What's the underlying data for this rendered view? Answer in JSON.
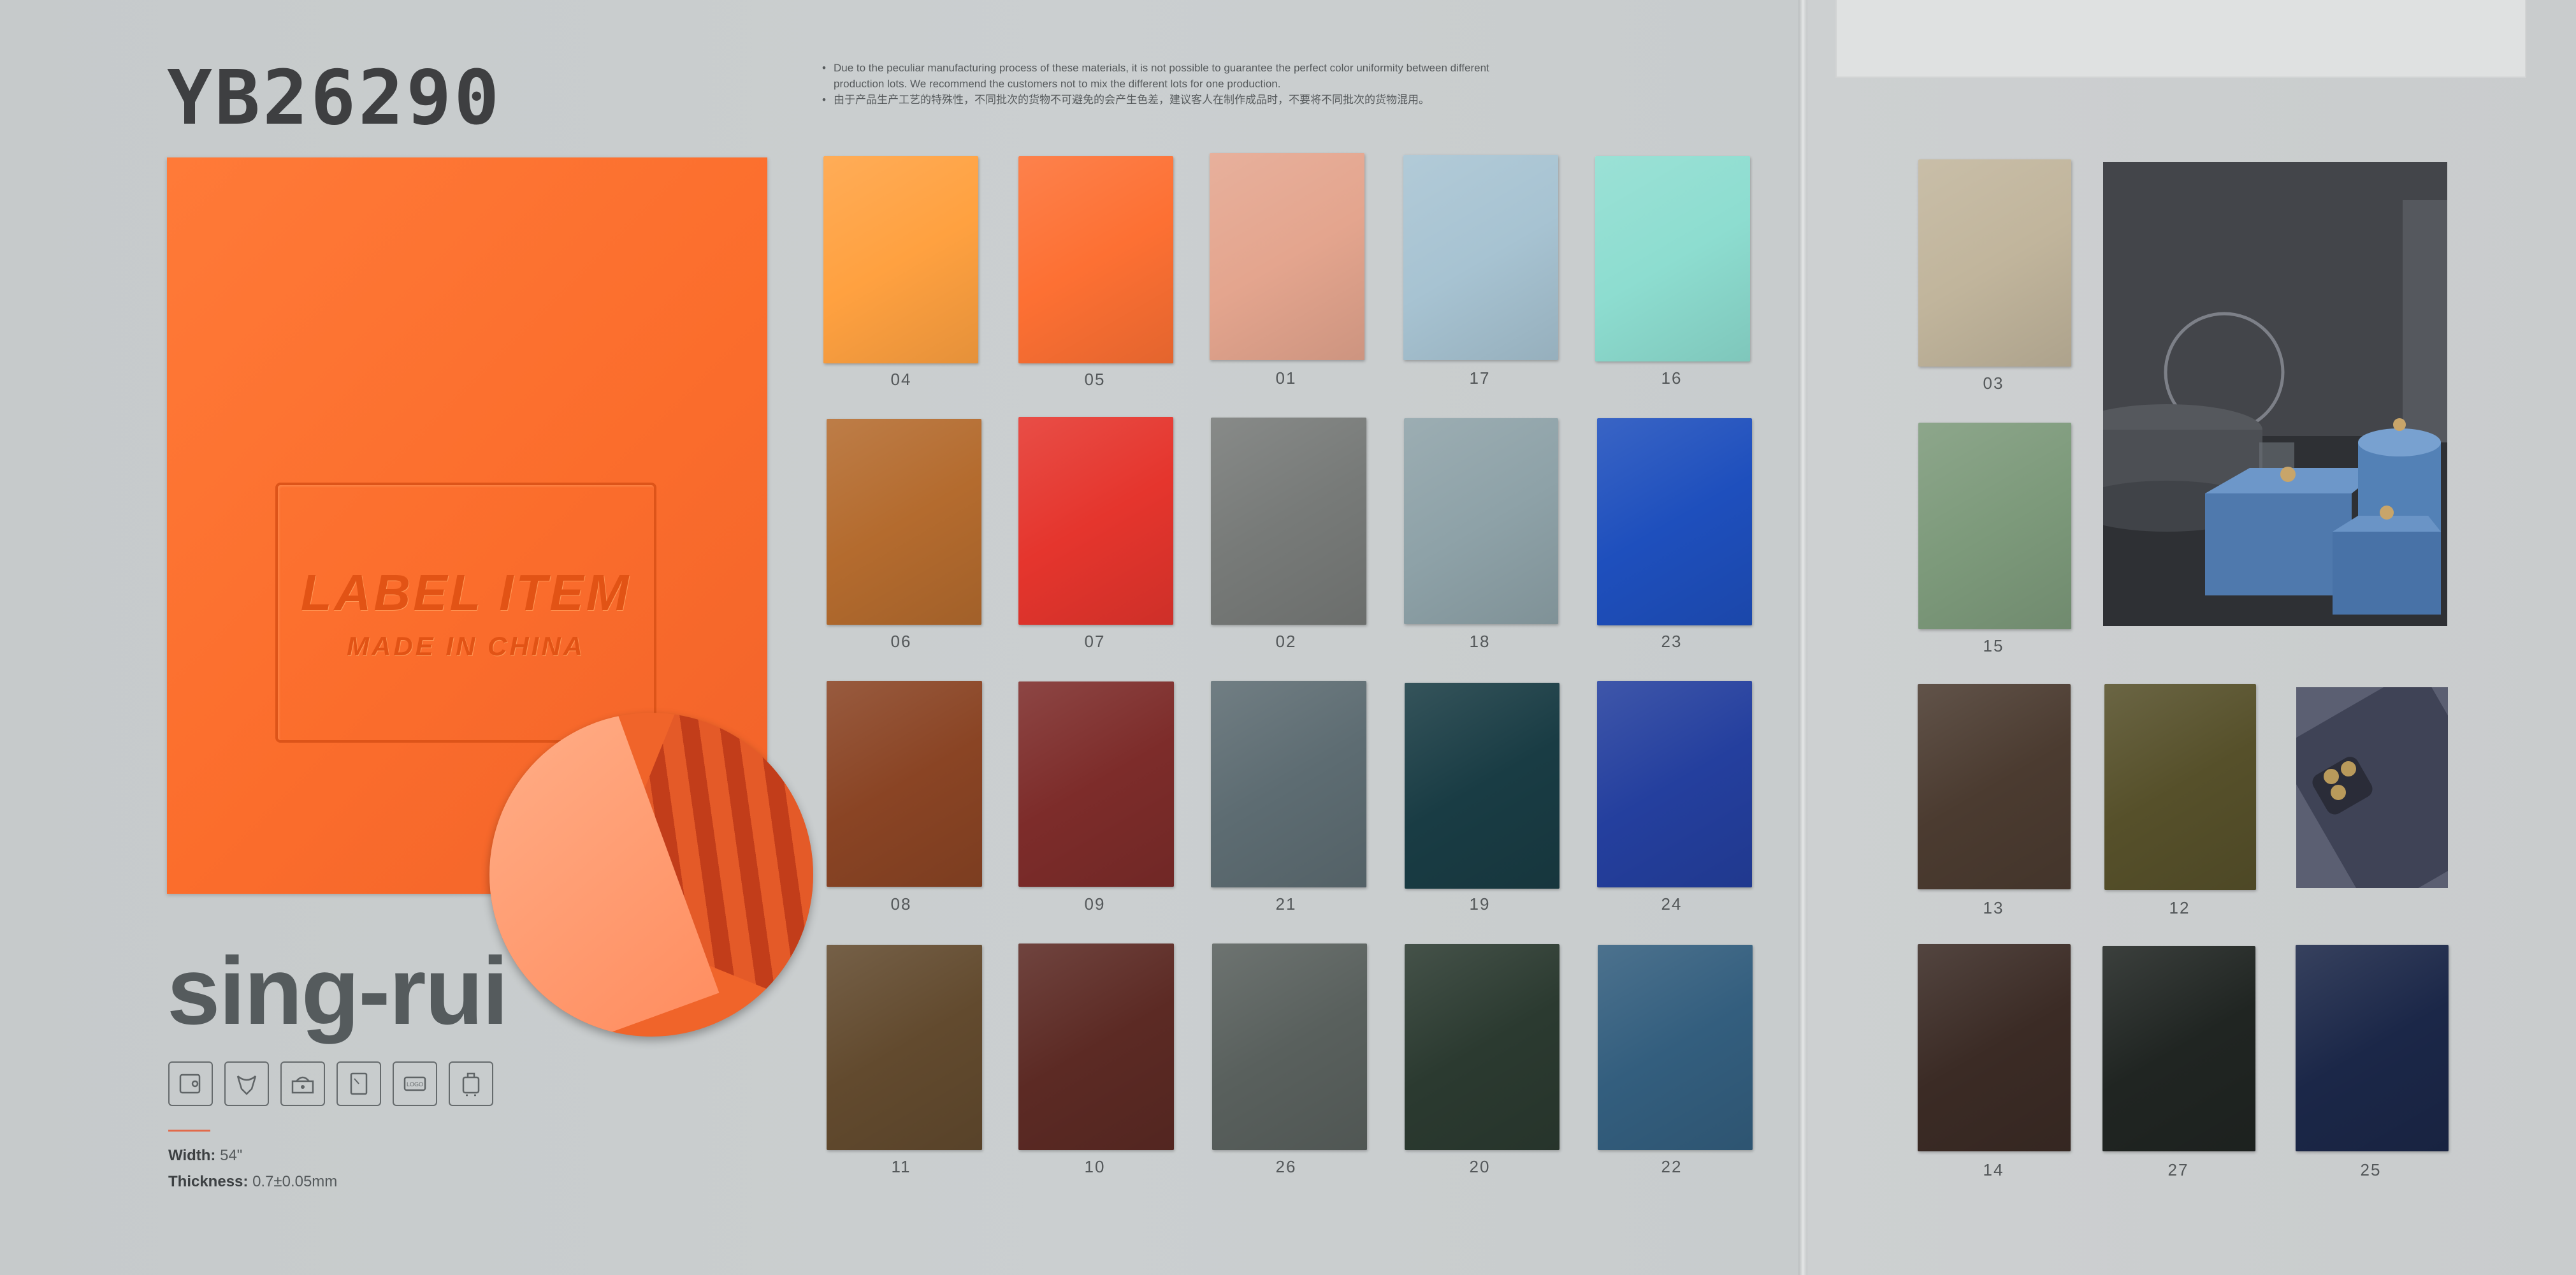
{
  "header": {
    "code": "YB26290",
    "notice": [
      "Due to the peculiar manufacturing process of these materials, it is not possible to guarantee the perfect color uniformity between different production lots. We recommend the customers not to mix the different lots for one production.",
      "由于产品生产工艺的特殊性，不同批次的货物不可避免的会产生色差，建议客人在制作成品时，不要将不同批次的货物混用。"
    ]
  },
  "hero": {
    "emboss_line1": "LABEL ITEM",
    "emboss_line2": "MADE IN CHINA",
    "color": "#fb6d2c"
  },
  "brand": "sing-rui",
  "usage_icons": [
    "wallet-icon",
    "bag-icon",
    "box-icon",
    "notebook-icon",
    "logo-label-icon",
    "suitcase-icon"
  ],
  "logo_label_text": "LOGO",
  "specs": {
    "width_label": "Width:",
    "width_value": "54\"",
    "thickness_label": "Thickness:",
    "thickness_value": "0.7±0.05mm"
  },
  "swatches": [
    {
      "code": "04",
      "color": "#ffa140"
    },
    {
      "code": "05",
      "color": "#fd7033"
    },
    {
      "code": "01",
      "color": "#e4a58e"
    },
    {
      "code": "17",
      "color": "#a7c3d2"
    },
    {
      "code": "16",
      "color": "#8dddd0"
    },
    {
      "code": "06",
      "color": "#b46b2e"
    },
    {
      "code": "07",
      "color": "#e5352d"
    },
    {
      "code": "02",
      "color": "#777a78"
    },
    {
      "code": "18",
      "color": "#8ea2a8"
    },
    {
      "code": "23",
      "color": "#1e4fbd"
    },
    {
      "code": "08",
      "color": "#8a4424"
    },
    {
      "code": "09",
      "color": "#7d2c2a"
    },
    {
      "code": "21",
      "color": "#5d6c72"
    },
    {
      "code": "19",
      "color": "#193c44"
    },
    {
      "code": "24",
      "color": "#243f9e"
    },
    {
      "code": "11",
      "color": "#624a2e"
    },
    {
      "code": "10",
      "color": "#5c2a24"
    },
    {
      "code": "26",
      "color": "#59605d"
    },
    {
      "code": "20",
      "color": "#2b3a30"
    },
    {
      "code": "22",
      "color": "#335e7e"
    },
    {
      "code": "03",
      "color": "#c1b59c"
    },
    {
      "code": "15",
      "color": "#7d9a7b"
    },
    {
      "code": "13",
      "color": "#4b3b30"
    },
    {
      "code": "12",
      "color": "#56502a"
    },
    {
      "code": "14",
      "color": "#3b2b25"
    },
    {
      "code": "27",
      "color": "#202522"
    },
    {
      "code": "25",
      "color": "#1b2748"
    }
  ]
}
